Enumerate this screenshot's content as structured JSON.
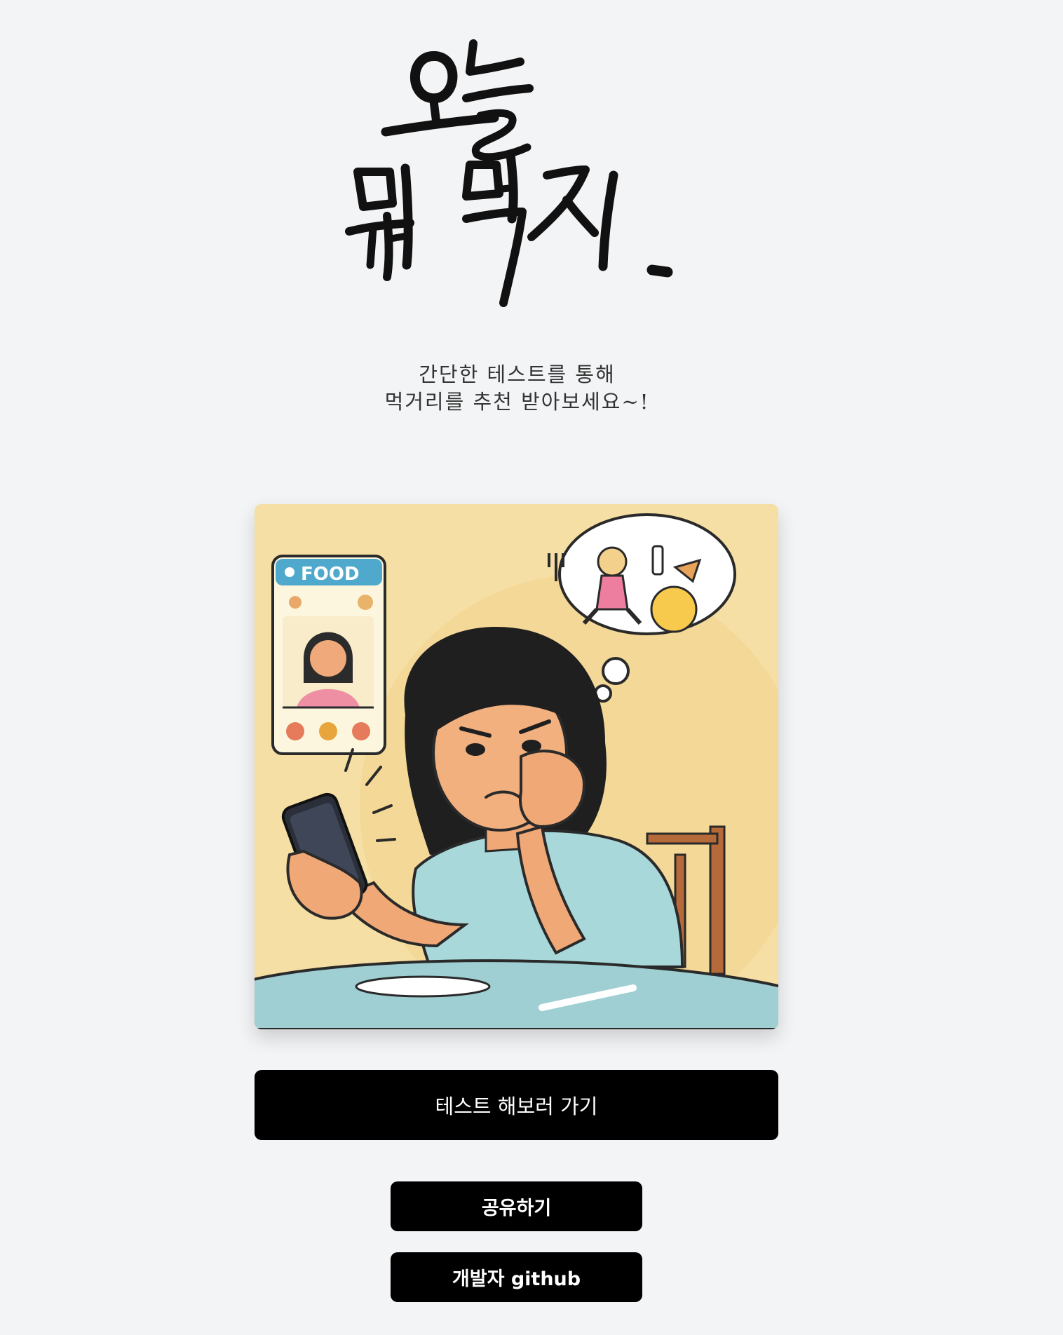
{
  "logo": {
    "line1": "오늘",
    "line2": "뭐 먹지."
  },
  "intro": {
    "line1": "간단한 테스트를 통해",
    "line2": "먹거리를 추천 받아보세요~!"
  },
  "illustration": {
    "phone_card_label": "FOOD"
  },
  "buttons": {
    "start_test": "테스트 해보러 가기",
    "share": "공유하기",
    "github": "개발자 github"
  },
  "colors": {
    "background": "#f3f4f6",
    "button": "#000000",
    "button_text": "#ffffff"
  }
}
